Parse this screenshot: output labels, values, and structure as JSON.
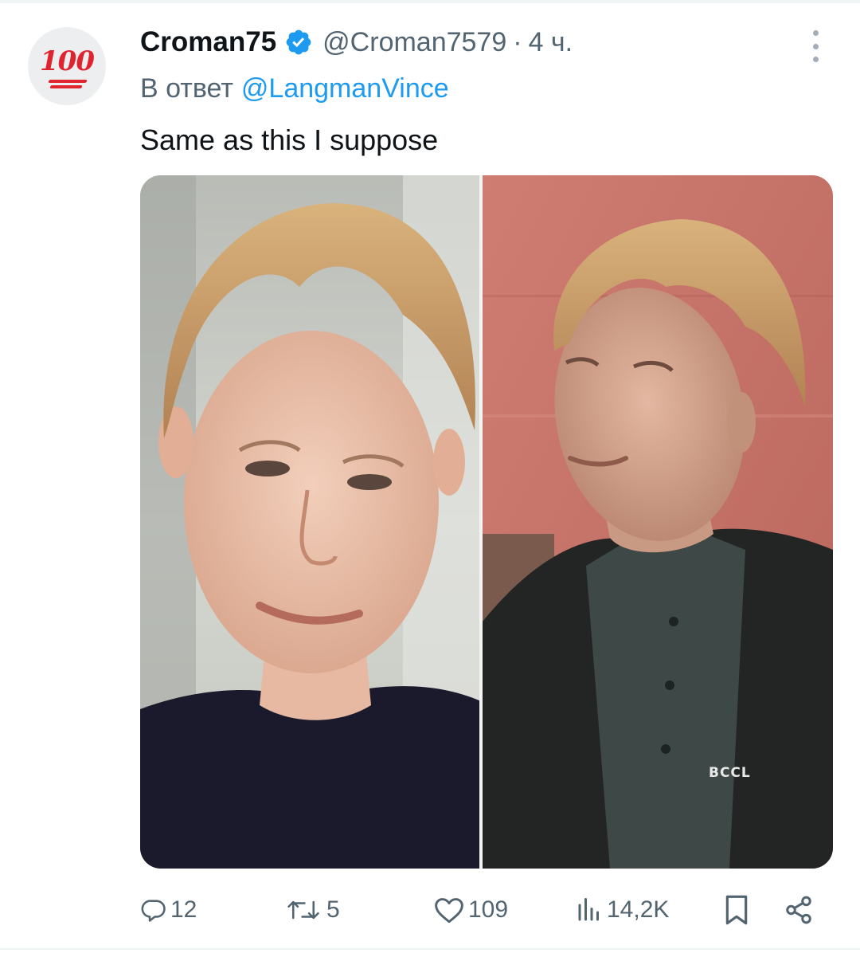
{
  "tweet": {
    "avatar_emoji": "100",
    "display_name": "Croman75",
    "verified_icon": "verified-badge-icon",
    "handle": "@Croman7579",
    "separator": "·",
    "time": "4 ч.",
    "reply_prefix": "В ответ",
    "reply_to": "@LangmanVince",
    "text": "Same as this I suppose",
    "media_watermark": "BCCL"
  },
  "actions": {
    "replies": "12",
    "retweets": "5",
    "likes": "109",
    "views": "14,2K"
  },
  "colors": {
    "text_primary": "#0f1419",
    "text_secondary": "#536471",
    "accent": "#1d9bf0",
    "avatar_red": "#e0242f"
  },
  "icons": [
    "more-icon",
    "reply-icon",
    "retweet-icon",
    "like-icon",
    "views-icon",
    "bookmark-icon",
    "share-icon"
  ]
}
